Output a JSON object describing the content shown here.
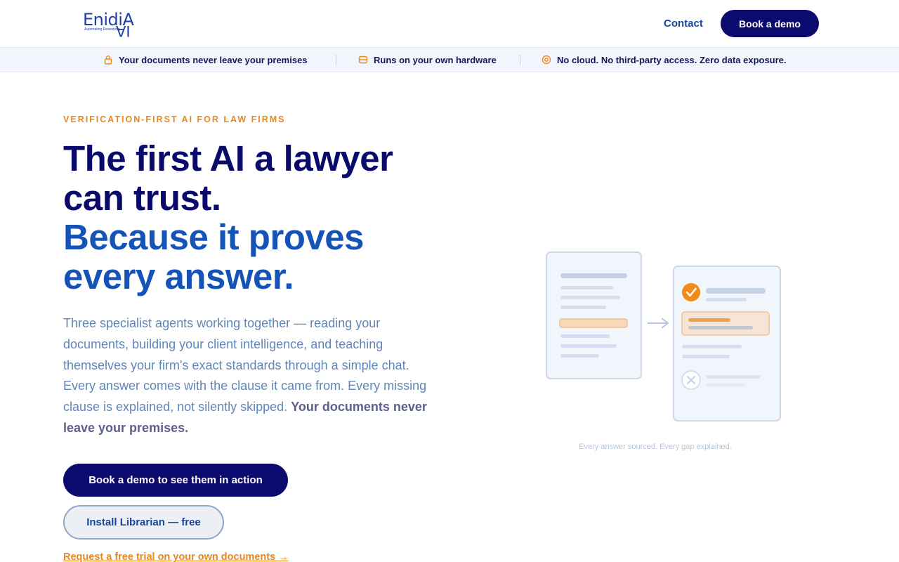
{
  "header": {
    "logo_word": "EnidiA",
    "logo_tag": "Automating Reasoning",
    "logo_flip": "AI",
    "contact_label": "Contact",
    "book_demo_label": "Book a demo"
  },
  "trust_strip": {
    "items": [
      {
        "icon": "lock-icon",
        "label": "Your documents never leave your premises"
      },
      {
        "icon": "server-icon",
        "label": "Runs on your own hardware"
      },
      {
        "icon": "shield-icon",
        "label": "No cloud. No third-party access. Zero data exposure."
      }
    ]
  },
  "hero": {
    "eyebrow": "VERIFICATION-FIRST AI FOR LAW FIRMS",
    "headline_1": "The first AI a lawyer can trust.",
    "headline_2": "Because it proves every answer.",
    "lead": "Three specialist agents working together — reading your documents, building your client intelligence, and teaching themselves your firm's exact standards through a simple chat. Every answer comes with the clause it came from. Every missing clause is explained, not silently skipped.",
    "lead_emphasis": "Your documents never leave your premises.",
    "cta_primary": "Book a demo to see them in action",
    "cta_secondary": "Install Librarian — free",
    "cta_link": "Request a free trial on your own documents →"
  },
  "illustration": {
    "caption": "Every answer sourced. Every gap explained.",
    "colors": {
      "accent": "#f28a17",
      "navy": "#0b0a6e",
      "card_bg": "#f1f5fc",
      "card_border": "#ccd8ea"
    }
  }
}
